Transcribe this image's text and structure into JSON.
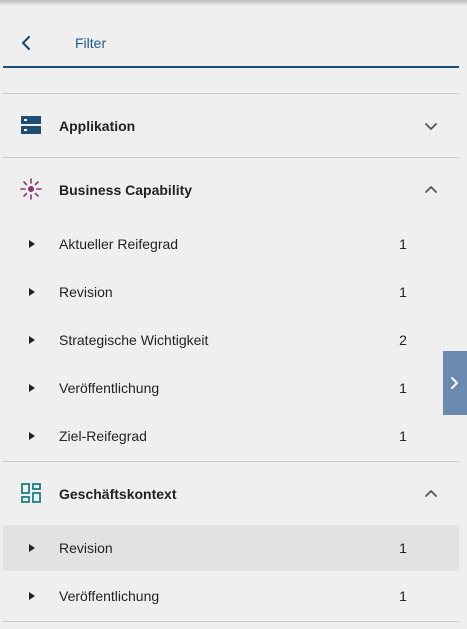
{
  "header": {
    "back_icon": "chevron-left-icon",
    "title": "Filter"
  },
  "colors": {
    "accent": "#1f4e75",
    "title_blue": "#1f5a8c",
    "business_capability_icon": "#8a3a6e",
    "context_icon": "#1f7f7f",
    "side_toggle": "#6a8ab0"
  },
  "sections": [
    {
      "label": "Applikation",
      "icon": "server-icon",
      "expanded": false,
      "items": []
    },
    {
      "label": "Business Capability",
      "icon": "capability-burst-icon",
      "expanded": true,
      "items": [
        {
          "label": "Aktueller Reifegrad",
          "count": "1"
        },
        {
          "label": "Revision",
          "count": "1"
        },
        {
          "label": "Strategische Wichtigkeit",
          "count": "2"
        },
        {
          "label": "Veröffentlichung",
          "count": "1"
        },
        {
          "label": "Ziel-Reifegrad",
          "count": "1"
        }
      ]
    },
    {
      "label": "Geschäftskontext",
      "icon": "dashboard-icon",
      "expanded": true,
      "items": [
        {
          "label": "Revision",
          "count": "1",
          "selected": true
        },
        {
          "label": "Veröffentlichung",
          "count": "1"
        }
      ]
    }
  ],
  "side_toggle": {
    "icon": "chevron-right-icon"
  }
}
